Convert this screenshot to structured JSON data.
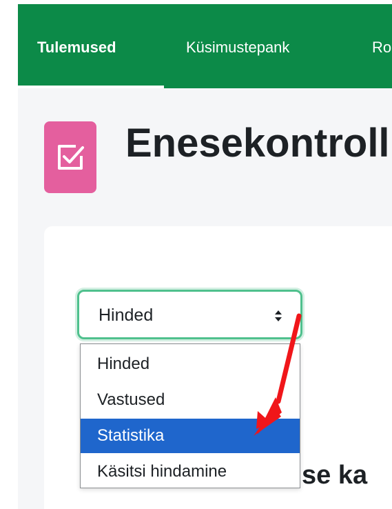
{
  "nav": {
    "tabs": [
      {
        "label": "Tulemused",
        "active": true
      },
      {
        "label": "Küsimustepank",
        "active": false
      },
      {
        "label": "Ro",
        "active": false
      }
    ]
  },
  "header": {
    "icon": "checkbox-icon",
    "title": "Enesekontroll"
  },
  "report_select": {
    "value": "Hinded",
    "options": [
      {
        "label": "Hinded",
        "selected": false
      },
      {
        "label": "Vastused",
        "selected": false
      },
      {
        "label": "Statistika",
        "selected": true
      },
      {
        "label": "Käsitsi hindamine",
        "selected": false
      }
    ]
  },
  "partial_heading": "se ka",
  "annotation": {
    "type": "red-arrow",
    "color": "#f0161a"
  },
  "colors": {
    "nav_background": "#0c8a48",
    "icon_background": "#e45f9e",
    "select_focus": "#4fc08d",
    "option_selected": "#1f66cc"
  }
}
